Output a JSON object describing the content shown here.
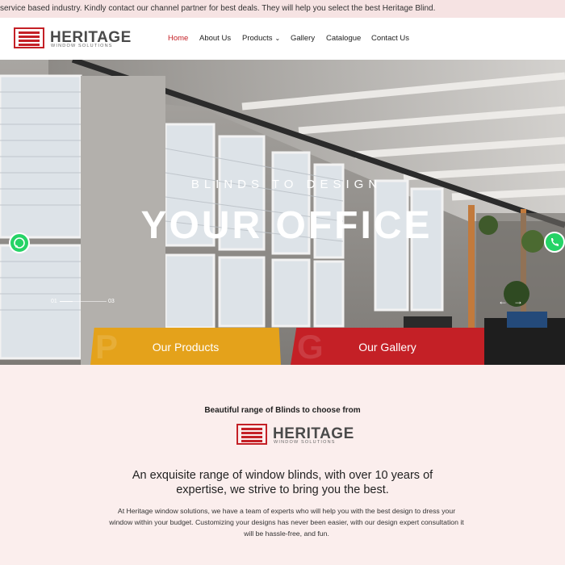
{
  "topbar": {
    "message": "service based industry. Kindly contact our channel partner for best deals. They will help you select the best Heritage Blind."
  },
  "brand": {
    "name": "HERITAGE",
    "tagline": "WINDOW SOLUTIONS",
    "logo_icon": "window-blind-icon",
    "accent_color": "#c42026",
    "secondary_color": "#e4a21b"
  },
  "nav": {
    "items": [
      {
        "label": "Home",
        "active": true
      },
      {
        "label": "About Us"
      },
      {
        "label": "Products",
        "dropdown": true
      },
      {
        "label": "Gallery"
      },
      {
        "label": "Catalogue"
      },
      {
        "label": "Contact Us"
      }
    ]
  },
  "hero": {
    "subtitle": "BLINDS TO DESIGN",
    "title": "YOUR OFFICE",
    "slider": {
      "current": "01",
      "total": "03"
    },
    "prev_icon": "arrow-left-icon",
    "next_icon": "arrow-right-icon",
    "whatsapp_icon": "whatsapp-icon",
    "phone_icon": "phone-icon"
  },
  "cta": {
    "products_label": "Our Products",
    "products_ghost": "P",
    "gallery_label": "Our Gallery",
    "gallery_ghost": "G"
  },
  "intro": {
    "kicker": "Beautiful range of Blinds to choose from",
    "heading": "An exquisite range of window blinds, with over 10 years of expertise, we strive to bring you the best.",
    "body": "At Heritage window solutions, we have a team of experts who will help you with the best design to dress your window within your budget. Customizing your designs has never been easier, with our design expert consultation it will be hassle-free, and fun."
  }
}
